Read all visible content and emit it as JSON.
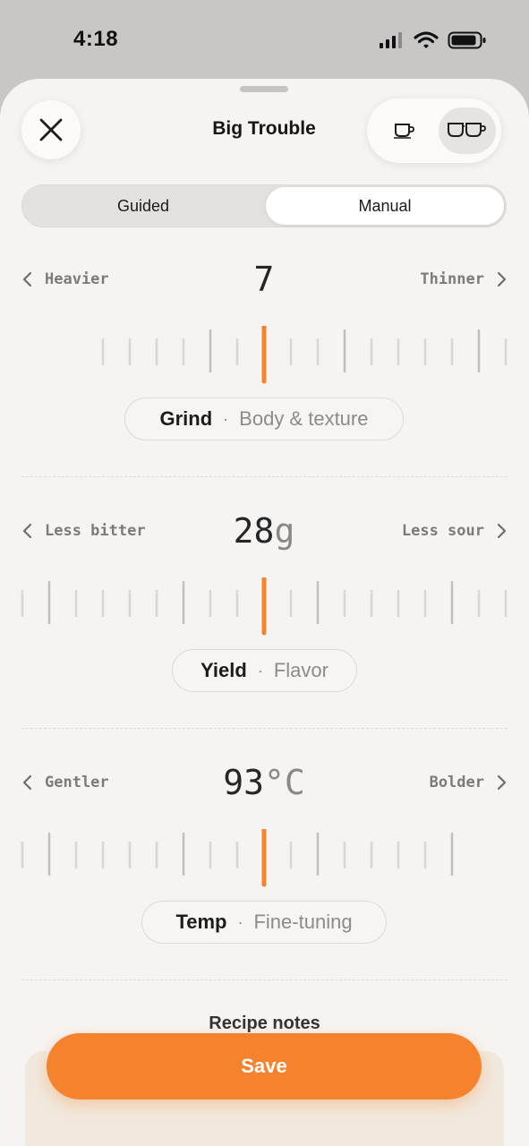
{
  "status_bar": {
    "time": "4:18"
  },
  "header": {
    "title": "Big Trouble",
    "close_icon": "close-icon",
    "cup_options": [
      "single-cup-icon",
      "double-cup-icon"
    ],
    "selected_cup": "double"
  },
  "mode_tabs": {
    "items": [
      "Guided",
      "Manual"
    ],
    "selected": "Manual"
  },
  "grind": {
    "left_label": "Heavier",
    "right_label": "Thinner",
    "value": "7",
    "unit": "",
    "pill_name": "Grind",
    "pill_dot": "·",
    "pill_desc": "Body & texture"
  },
  "yield": {
    "left_label": "Less bitter",
    "right_label": "Less sour",
    "value": "28",
    "unit": "g",
    "pill_name": "Yield",
    "pill_dot": "·",
    "pill_desc": "Flavor"
  },
  "temp": {
    "left_label": "Gentler",
    "right_label": "Bolder",
    "value": "93",
    "unit": "°C",
    "pill_name": "Temp",
    "pill_dot": "·",
    "pill_desc": "Fine-tuning"
  },
  "notes": {
    "title": "Recipe notes"
  },
  "save_button": {
    "label": "Save"
  },
  "colors": {
    "accent": "#f5832d",
    "background": "#f6f4f2"
  }
}
